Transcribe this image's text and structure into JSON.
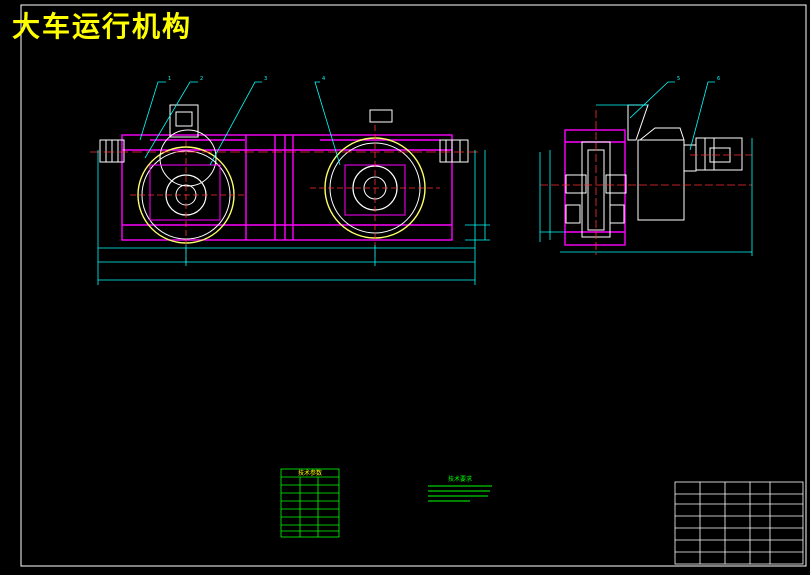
{
  "title": "大车运行机构",
  "colors": {
    "background": "#000000",
    "frame": "#ffffff",
    "title": "#ffff00",
    "outline": "#ff00ff",
    "dimension": "#00ffff",
    "parts": "#ffffff",
    "wheel": "#ffff66",
    "centerline": "#ff3030",
    "notes": "#00ff00",
    "green_box": "#00ff00"
  },
  "leader_labels": [
    "1",
    "2",
    "3",
    "4",
    "5",
    "6"
  ],
  "tech_params_title": "技术参数",
  "tech_notes_title": "技术要求"
}
